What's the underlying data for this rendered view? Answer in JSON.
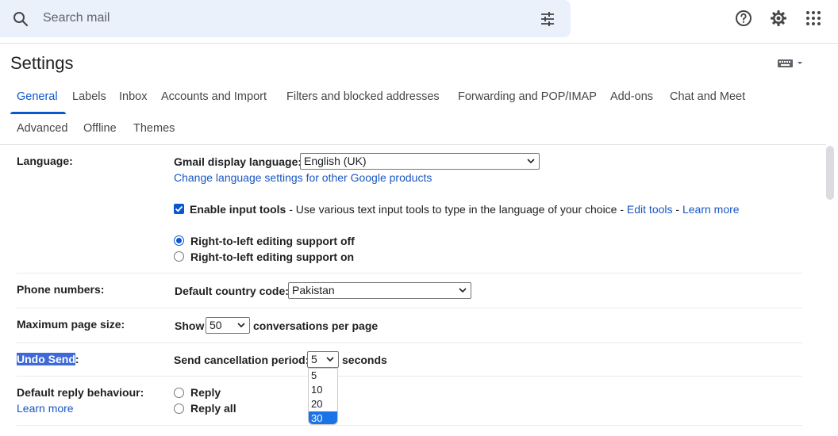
{
  "search": {
    "placeholder": "Search mail"
  },
  "header": {
    "title": "Settings"
  },
  "tabs_row1": [
    {
      "label": "General",
      "active": true
    },
    {
      "label": "Labels"
    },
    {
      "label": "Inbox"
    },
    {
      "label": "Accounts and Import"
    },
    {
      "label": "Filters and blocked addresses"
    },
    {
      "label": "Forwarding and POP/IMAP"
    },
    {
      "label": "Add-ons"
    },
    {
      "label": "Chat and Meet"
    }
  ],
  "tabs_row2": [
    {
      "label": "Advanced"
    },
    {
      "label": "Offline"
    },
    {
      "label": "Themes"
    }
  ],
  "language": {
    "label": "Language:",
    "display_label": "Gmail display language:",
    "display_value": "English (UK)",
    "change_link": "Change language settings for other Google products",
    "input_tools_bold": "Enable input tools",
    "input_tools_desc": " - Use various text input tools to type in the language of your choice - ",
    "edit_tools": "Edit tools",
    "dash": " - ",
    "learn_more": "Learn more",
    "rtl_off": "Right-to-left editing support off",
    "rtl_on": "Right-to-left editing support on"
  },
  "phone": {
    "label": "Phone numbers:",
    "country_label": "Default country code:",
    "country_value": "Pakistan"
  },
  "page_size": {
    "label": "Maximum page size:",
    "show": "Show",
    "value": "50",
    "suffix": "conversations per page"
  },
  "undo_send": {
    "label_highlighted": "Undo Send",
    "label_colon": ":",
    "period_label": "Send cancellation period:",
    "value": "5",
    "suffix": "seconds",
    "options": [
      "5",
      "10",
      "20",
      "30"
    ],
    "hovered_option": "30"
  },
  "reply": {
    "label": "Default reply behaviour:",
    "learn_more": "Learn more",
    "reply": "Reply",
    "reply_all": "Reply all"
  },
  "colors": {
    "accent": "#0b57d0",
    "link": "#1a56c3",
    "search_bg": "#eaf1fb"
  }
}
